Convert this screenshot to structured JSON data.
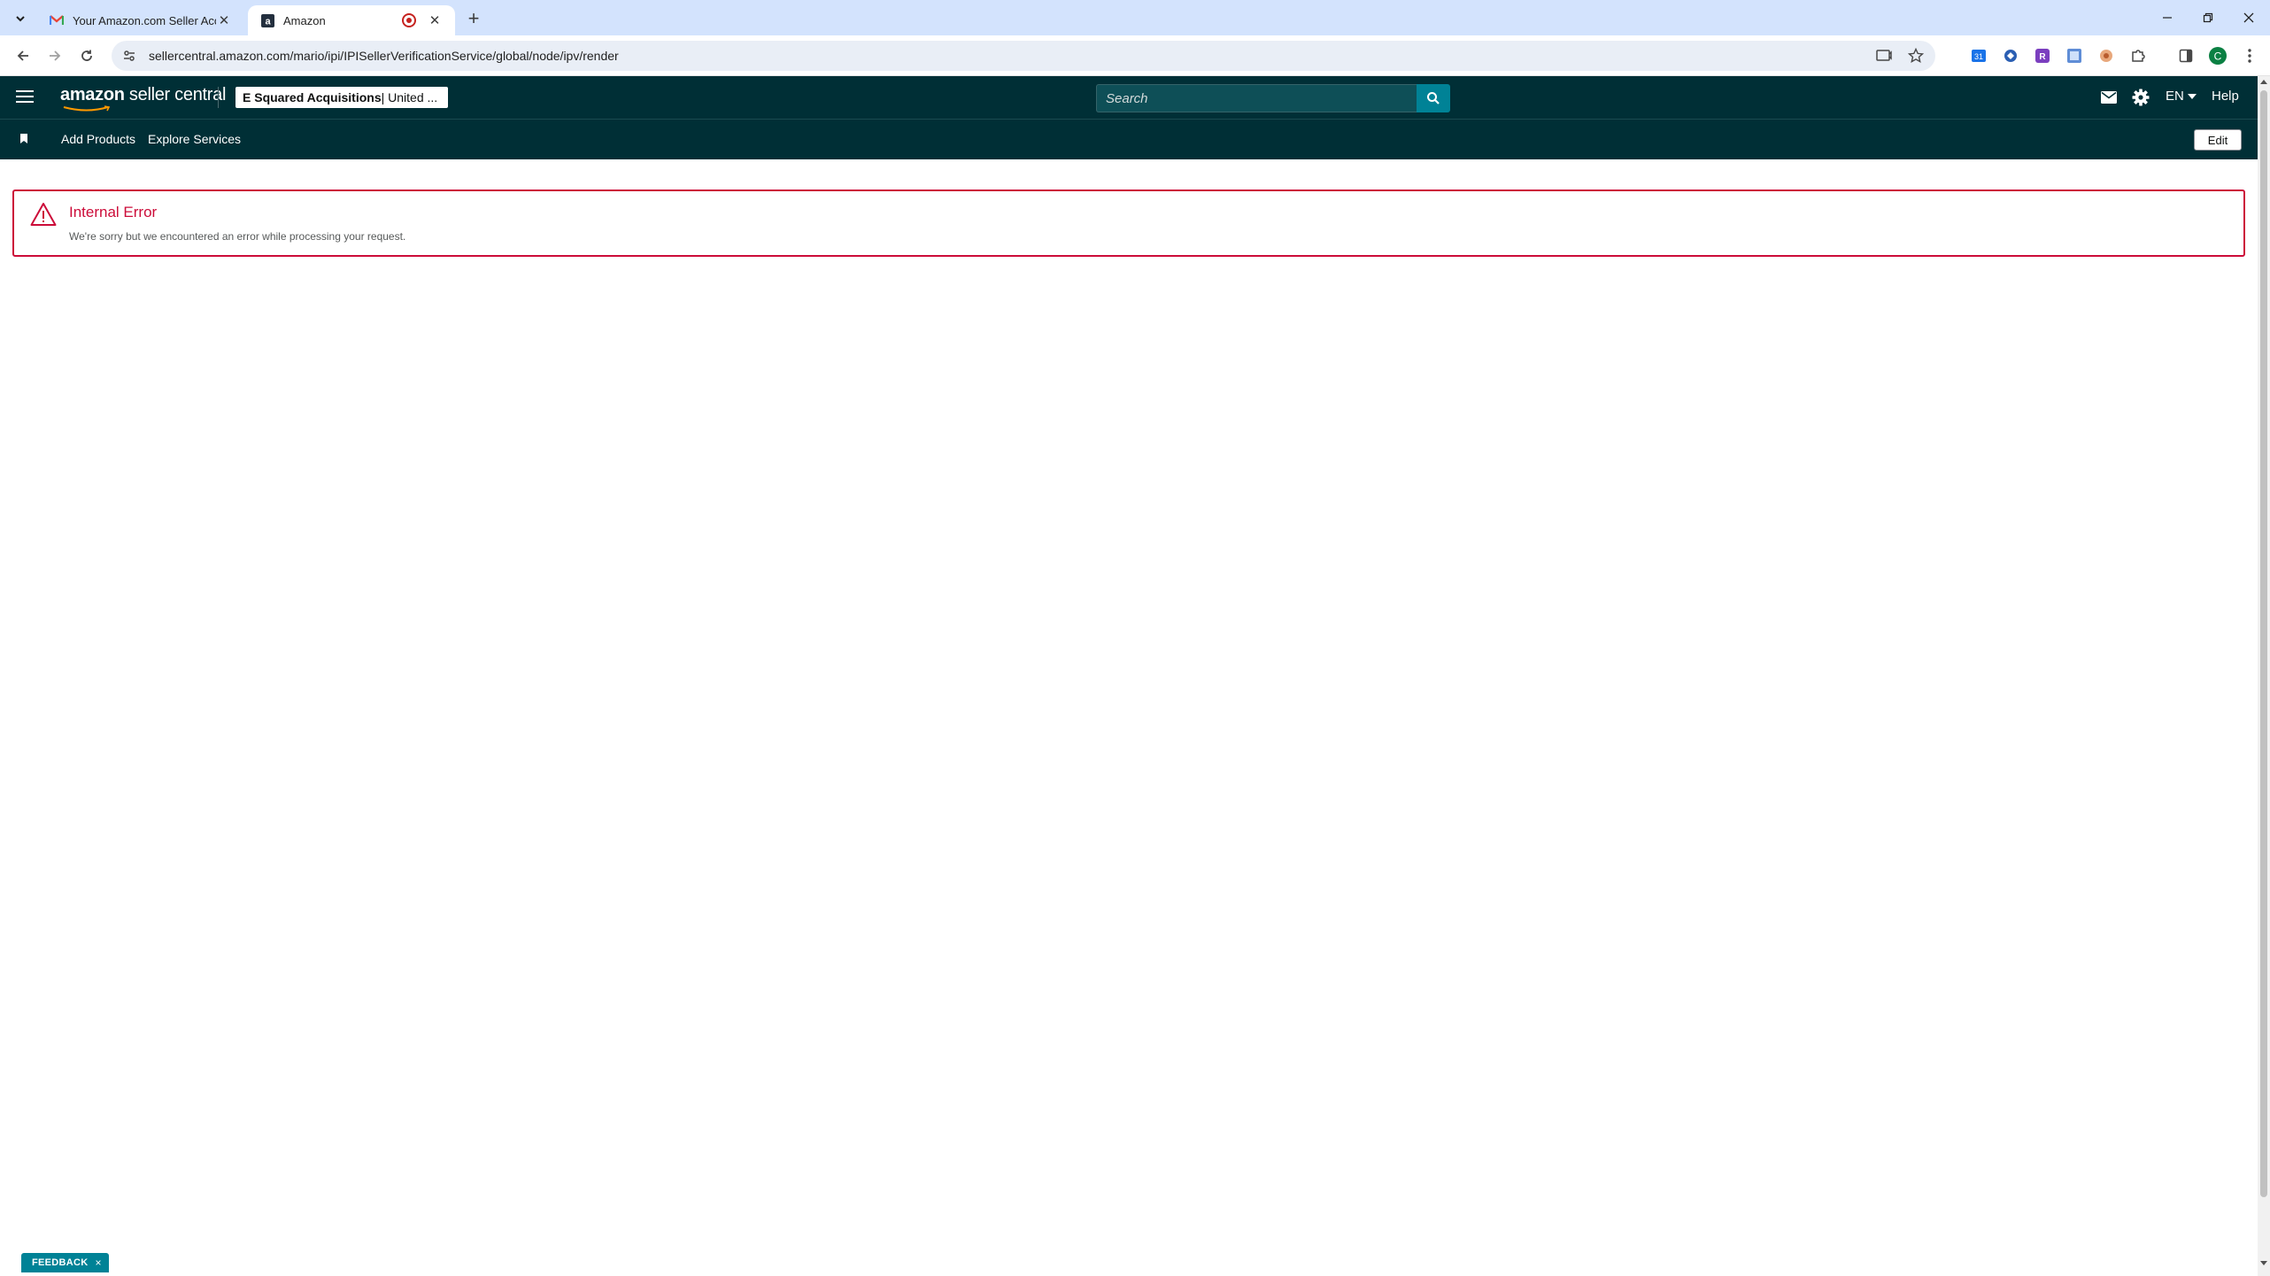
{
  "browser": {
    "tabs": [
      {
        "title": "Your Amazon.com Seller Accou",
        "favicon": "gmail-icon",
        "active": false
      },
      {
        "title": "Amazon",
        "favicon": "amazon-icon",
        "active": true
      }
    ],
    "url": "sellercentral.amazon.com/mario/ipi/IPISellerVerificationService/global/node/ipv/render",
    "profile_initial": "C"
  },
  "header": {
    "logo_amazon": "amazon",
    "logo_rest": " seller central",
    "account_name": "E Squared Acquisitions",
    "account_region": " | United ...",
    "search_placeholder": "Search",
    "language": "EN",
    "help_label": "Help"
  },
  "nav": {
    "links": [
      "Add Products",
      "Explore Services"
    ],
    "edit_label": "Edit"
  },
  "alert": {
    "title": "Internal Error",
    "message": "We're sorry but we encountered an error while processing your request."
  },
  "feedback": {
    "label": "FEEDBACK",
    "close": "×"
  },
  "colors": {
    "header_bg": "#002f36",
    "accent_teal": "#008296",
    "error_red": "#cc0c39"
  }
}
